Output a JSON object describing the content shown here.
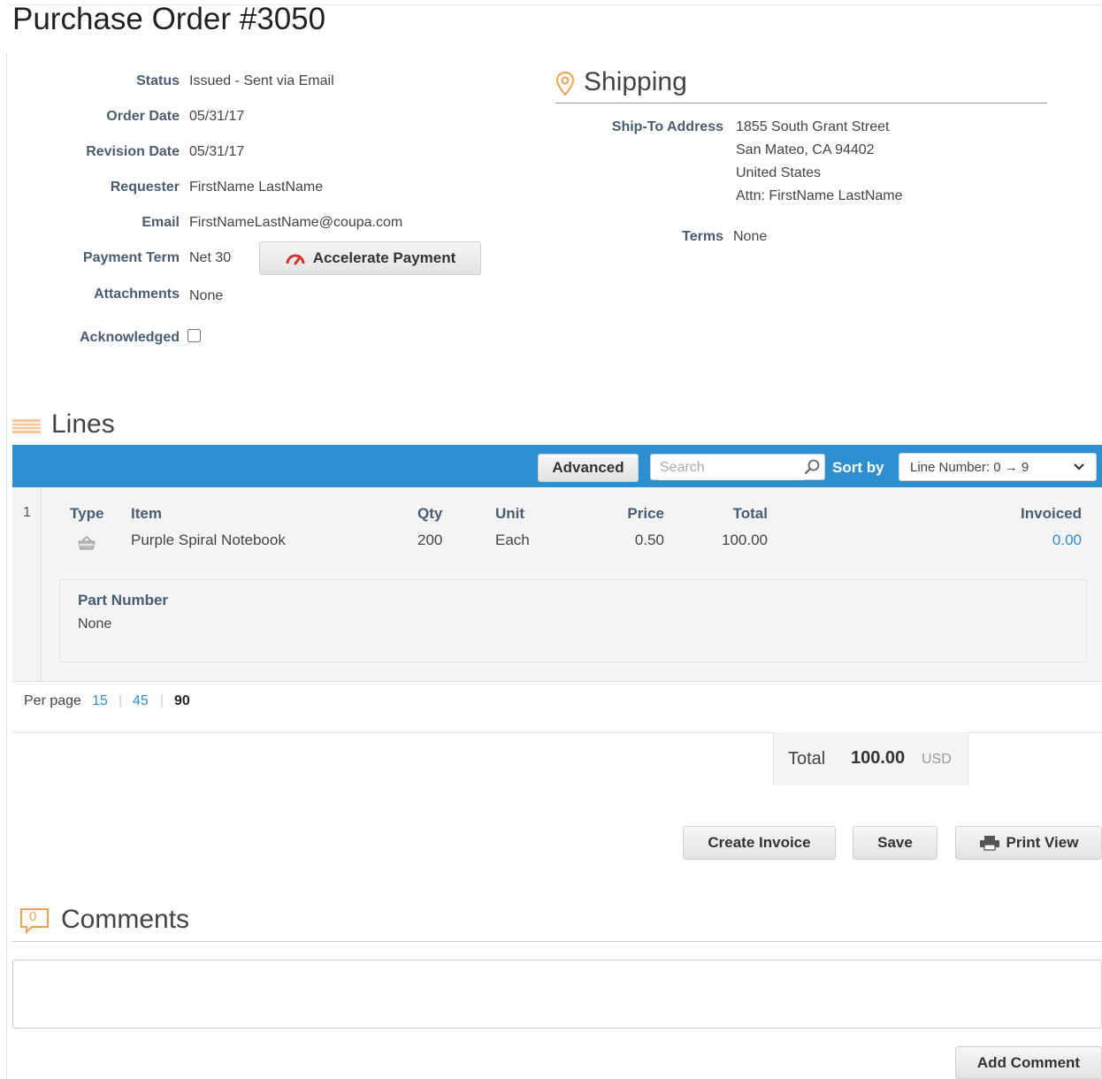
{
  "page": {
    "title": "Purchase Order #3050"
  },
  "details": {
    "status_label": "Status",
    "status_value": "Issued - Sent via Email",
    "order_date_label": "Order Date",
    "order_date_value": "05/31/17",
    "revision_date_label": "Revision Date",
    "revision_date_value": "05/31/17",
    "requester_label": "Requester",
    "requester_value": "FirstName LastName",
    "email_label": "Email",
    "email_value": "FirstNameLastName@coupa.com",
    "payment_term_label": "Payment Term",
    "payment_term_value": "Net 30",
    "accelerate_payment_label": "Accelerate Payment",
    "attachments_label": "Attachments",
    "attachments_value": "None",
    "acknowledged_label": "Acknowledged",
    "acknowledged_checked": false
  },
  "shipping": {
    "heading": "Shipping",
    "ship_to_label": "Ship-To Address",
    "address_lines": [
      "1855 South Grant Street",
      "San Mateo, CA 94402",
      "United States",
      "Attn: FirstName LastName"
    ],
    "terms_label": "Terms",
    "terms_value": "None"
  },
  "lines": {
    "heading": "Lines",
    "advanced_label": "Advanced",
    "search_placeholder": "Search",
    "sort_by_label": "Sort by",
    "sort_value": "Line Number: 0 → 9",
    "columns": {
      "type": "Type",
      "item": "Item",
      "qty": "Qty",
      "unit": "Unit",
      "price": "Price",
      "total": "Total",
      "invoiced": "Invoiced"
    },
    "rows": [
      {
        "number": "1",
        "item": "Purple Spiral Notebook",
        "qty": "200",
        "unit": "Each",
        "price": "0.50",
        "total": "100.00",
        "invoiced": "0.00",
        "type_icon": "basket-icon",
        "part_number_label": "Part Number",
        "part_number_value": "None"
      }
    ],
    "per_page_label": "Per page",
    "per_page_options": [
      "15",
      "45",
      "90"
    ],
    "per_page_selected": "90"
  },
  "summary": {
    "total_label": "Total",
    "total_value": "100.00",
    "currency": "USD"
  },
  "actions": {
    "create_invoice_label": "Create Invoice",
    "save_label": "Save",
    "print_view_label": "Print View"
  },
  "comments": {
    "heading": "Comments",
    "count": "0",
    "add_comment_label": "Add Comment"
  },
  "colors": {
    "accent_blue": "#2d8ed0",
    "label_color": "#4a5c72",
    "orange_icon": "#f0a050",
    "gauge_red": "#d9342b"
  }
}
